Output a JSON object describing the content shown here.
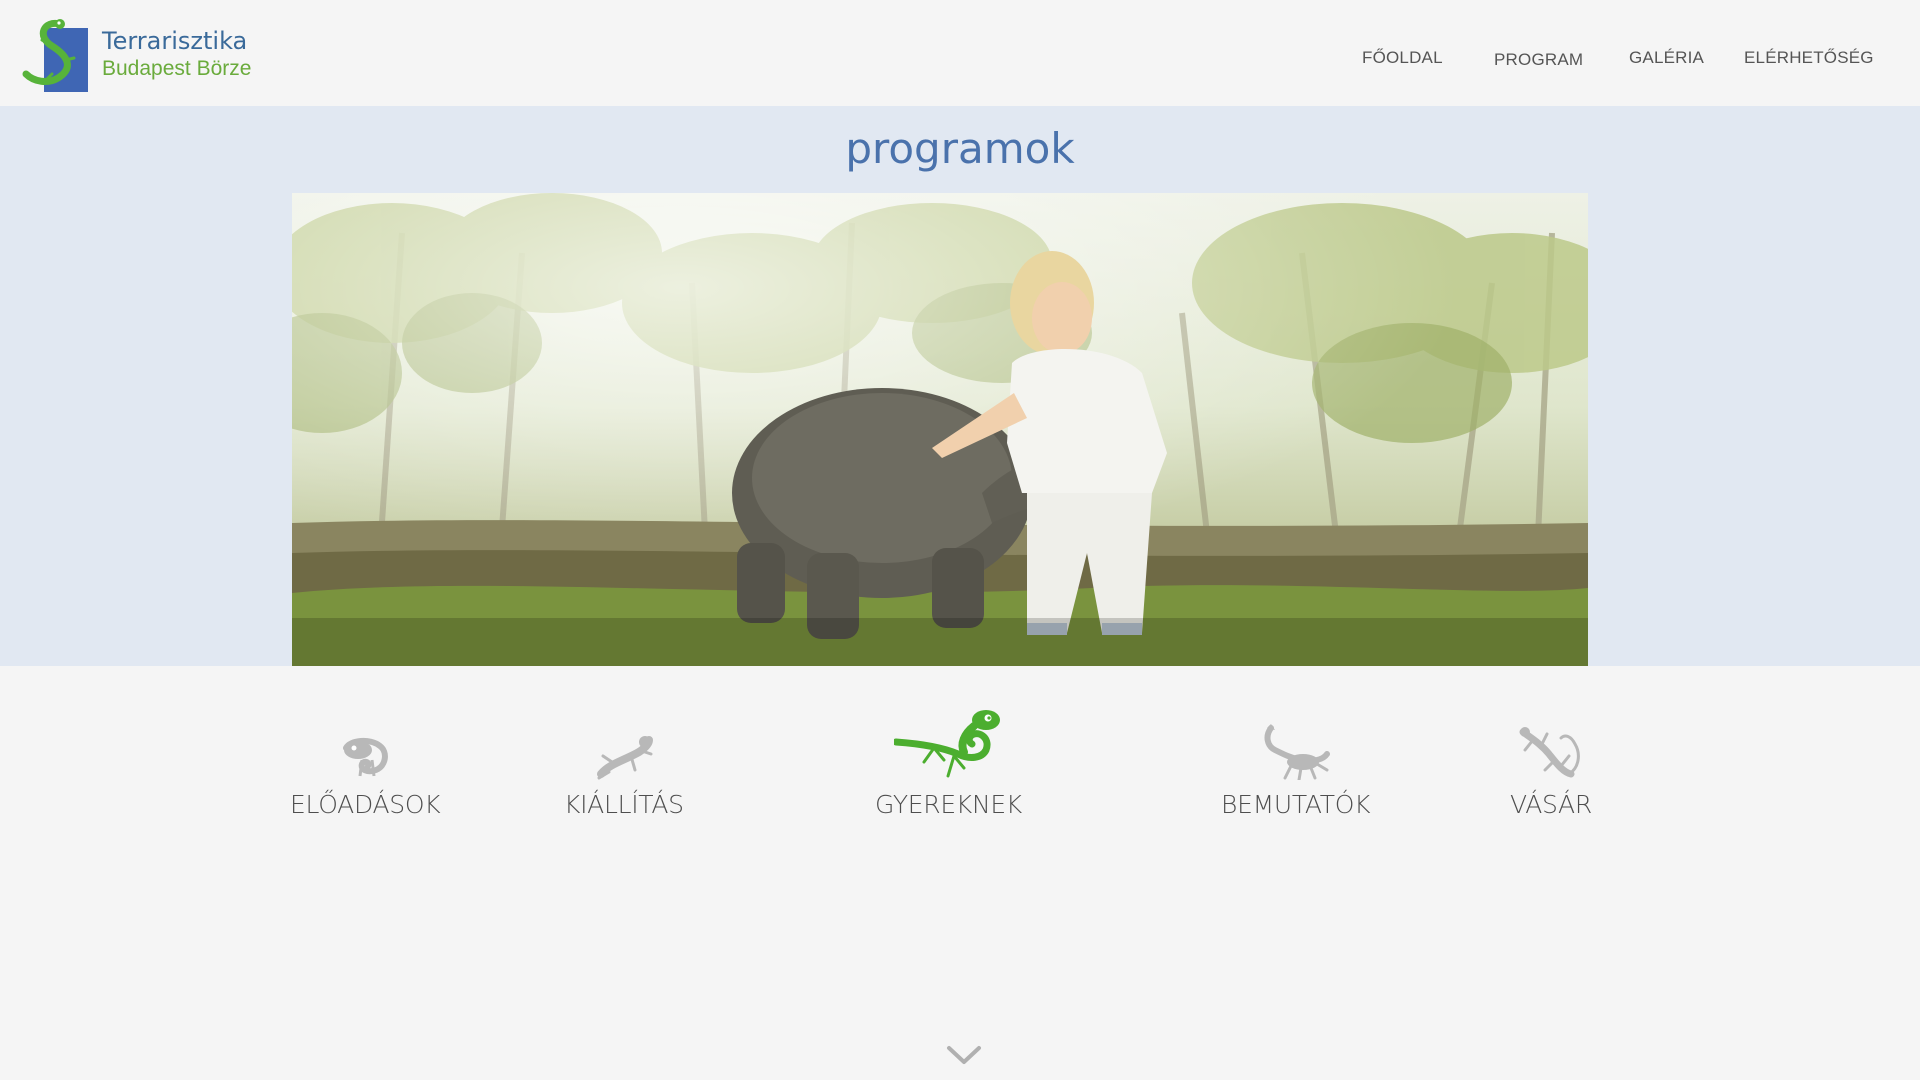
{
  "brand": {
    "title": "Terrarisztika",
    "subtitle": "Budapest Börze"
  },
  "nav": {
    "items": [
      {
        "label": "Főoldal"
      },
      {
        "label": "Program"
      },
      {
        "label": "Galéria"
      },
      {
        "label": "Elérhetőség"
      }
    ]
  },
  "hero": {
    "title": "programok"
  },
  "categories": [
    {
      "label": "Előadások",
      "icon": "chameleon-icon"
    },
    {
      "label": "Kiállítás",
      "icon": "frog-icon"
    },
    {
      "label": "Gyereknek",
      "icon": "lizard-icon"
    },
    {
      "label": "Bemutatók",
      "icon": "scorpion-icon"
    },
    {
      "label": "Vásár",
      "icon": "gecko-icon"
    }
  ],
  "colors": {
    "accent": "#4a72ac",
    "brand_green": "#6aab3c",
    "hero_bg": "#e1e8f2",
    "icon_grey": "#b8b8b8",
    "icon_active": "#4cae2f"
  },
  "scroll_hint": {
    "icon": "chevron-down-icon"
  }
}
